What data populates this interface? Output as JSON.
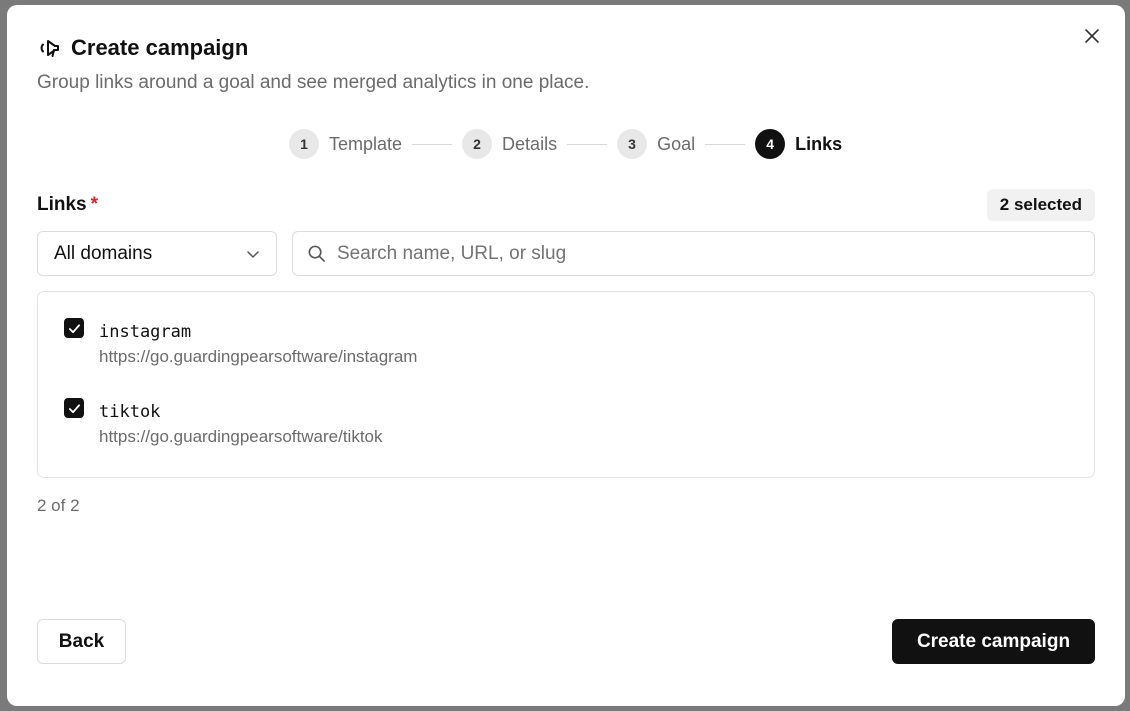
{
  "dialog": {
    "title": "Create campaign",
    "subtitle": "Group links around a goal and see merged analytics in one place."
  },
  "steps": [
    {
      "num": "1",
      "label": "Template"
    },
    {
      "num": "2",
      "label": "Details"
    },
    {
      "num": "3",
      "label": "Goal"
    },
    {
      "num": "4",
      "label": "Links"
    }
  ],
  "links_section": {
    "label": "Links",
    "required_mark": "*",
    "selected_badge": "2 selected",
    "domain_filter": "All domains",
    "search_placeholder": "Search name, URL, or slug",
    "items": [
      {
        "slug": "instagram",
        "url": "https://go.guardingpearsoftware/instagram",
        "checked": true
      },
      {
        "slug": "tiktok",
        "url": "https://go.guardingpearsoftware/tiktok",
        "checked": true
      }
    ],
    "count": "2 of 2"
  },
  "footer": {
    "back_label": "Back",
    "create_label": "Create campaign"
  },
  "colors": {
    "primary": "#111111",
    "required": "#dc2626",
    "muted_text": "#6b6b6b"
  },
  "icons": {
    "title": "megaphone-icon",
    "close": "close-icon",
    "dropdown": "chevron-down-icon",
    "search": "search-icon",
    "checkbox": "check-icon"
  }
}
